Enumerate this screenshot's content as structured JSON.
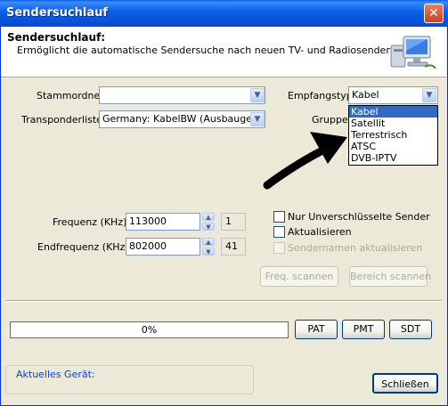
{
  "window": {
    "title": "Sendersuchlauf",
    "close_glyph": "✕"
  },
  "header": {
    "title": "Sendersuchlauf:",
    "description": "Ermöglicht die automatische Sendersuche nach neuen TV- und Radiosendern.",
    "icon": "computer-network-icon"
  },
  "form": {
    "stammordner": {
      "label": "Stammordner",
      "value": ""
    },
    "transponder": {
      "label": "Transponderliste",
      "value": "Germany: KabelBW (Ausbaugebiet"
    },
    "empfangstyp": {
      "label": "Empfangstyp",
      "value": "Kabel"
    },
    "gruppe": {
      "label": "Gruppe"
    },
    "dropdown_options": [
      "Kabel",
      "Satellit",
      "Terrestrisch",
      "ATSC",
      "DVB-IPTV"
    ],
    "dropdown_selected": "Kabel",
    "frequenz": {
      "label": "Frequenz (KHz)",
      "value": "113000",
      "index": "1"
    },
    "endfrequenz": {
      "label": "Endfrequenz (KHz)",
      "value": "802000",
      "index": "41"
    }
  },
  "options": {
    "unverschluesselt": {
      "label": "Nur Unverschlüsselte Sender",
      "checked": false
    },
    "aktualisieren": {
      "label": "Aktualisieren",
      "checked": false
    },
    "sendernamen": {
      "label": "Sendernamen aktualisieren",
      "checked": false,
      "enabled": false
    }
  },
  "buttons": {
    "freq_scan": "Freq. scannen",
    "range_scan": "Bereich scannen",
    "pat": "PAT",
    "pmt": "PMT",
    "sdt": "SDT",
    "close": "Schließen"
  },
  "progress": {
    "text": "0%",
    "value": 0
  },
  "device_group": {
    "label": "Aktuelles Gerät:"
  },
  "colors": {
    "titlebar": "#0a5ee8",
    "selection": "#316ac5",
    "window_bg": "#ece9d8"
  }
}
